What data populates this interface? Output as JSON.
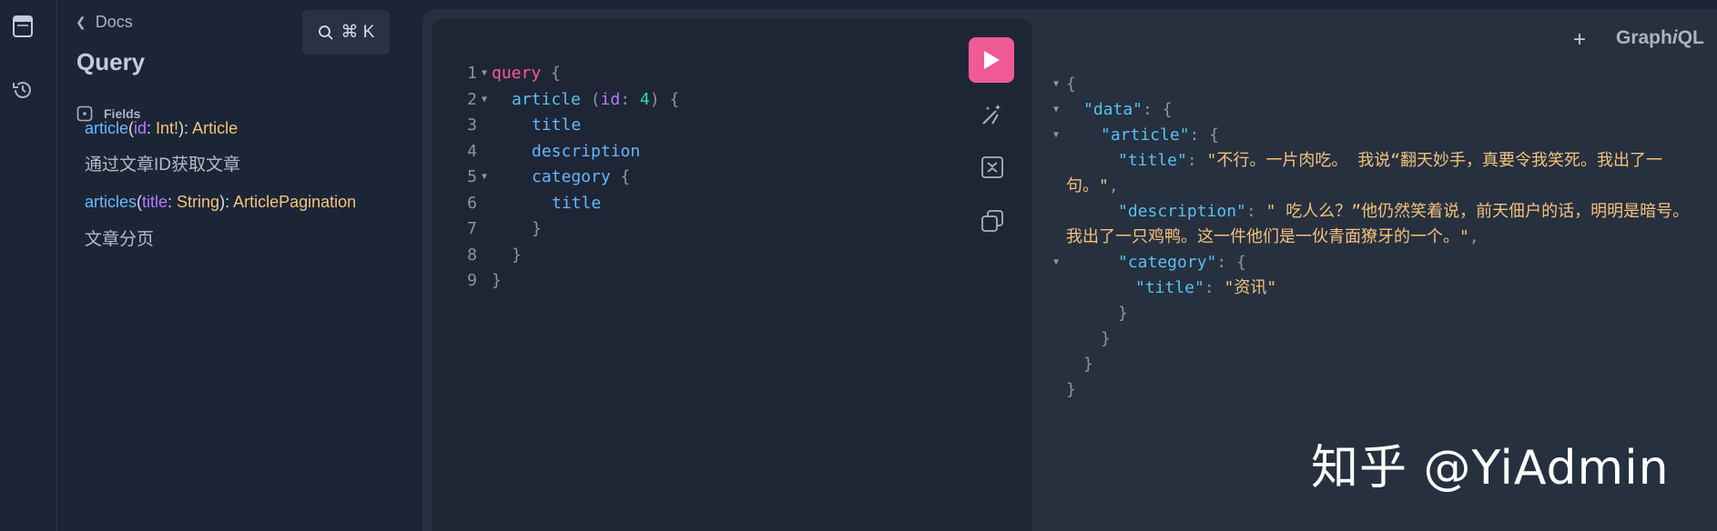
{
  "rail": {
    "icons": [
      "docs-icon",
      "history-icon"
    ]
  },
  "docs": {
    "back_label": "Docs",
    "search_label": "⌘ K",
    "title": "Query",
    "fields_label": "Fields",
    "fields": [
      {
        "name": "article",
        "args": [
          {
            "name": "id",
            "type": "Int!"
          }
        ],
        "type": "Article",
        "description": "通过文章ID获取文章"
      },
      {
        "name": "articles",
        "args": [
          {
            "name": "title",
            "type": "String"
          }
        ],
        "type": "ArticlePagination",
        "description": "文章分页"
      }
    ]
  },
  "editor": {
    "line_numbers": [
      "1",
      "2",
      "3",
      "4",
      "5",
      "6",
      "7",
      "8",
      "9"
    ],
    "lines": [
      {
        "segments": [
          {
            "t": "query",
            "c": "kw"
          },
          {
            "t": " {",
            "c": "pc"
          }
        ],
        "indent": 0,
        "fold": true
      },
      {
        "segments": [
          {
            "t": "article",
            "c": "fn"
          },
          {
            "t": " (",
            "c": "pc"
          },
          {
            "t": "id",
            "c": "ag"
          },
          {
            "t": ": ",
            "c": "pc"
          },
          {
            "t": "4",
            "c": "nm"
          },
          {
            "t": ") {",
            "c": "pc"
          }
        ],
        "indent": 1,
        "fold": true
      },
      {
        "segments": [
          {
            "t": "title",
            "c": "fd"
          }
        ],
        "indent": 2,
        "fold": false
      },
      {
        "segments": [
          {
            "t": "description",
            "c": "fd"
          }
        ],
        "indent": 2,
        "fold": false
      },
      {
        "segments": [
          {
            "t": "category",
            "c": "fd"
          },
          {
            "t": " {",
            "c": "pc"
          }
        ],
        "indent": 2,
        "fold": true
      },
      {
        "segments": [
          {
            "t": "title",
            "c": "fd"
          }
        ],
        "indent": 3,
        "fold": false
      },
      {
        "segments": [
          {
            "t": "}",
            "c": "pc"
          }
        ],
        "indent": 2,
        "fold": false
      },
      {
        "segments": [
          {
            "t": "}",
            "c": "pc"
          }
        ],
        "indent": 1,
        "fold": false
      },
      {
        "segments": [
          {
            "t": "}",
            "c": "pc"
          }
        ],
        "indent": 0,
        "fold": false
      }
    ]
  },
  "toolbar": {
    "run_label": "Run",
    "prettify": "prettify-icon",
    "merge": "merge-fragments-icon",
    "copy": "copy-icon"
  },
  "result_header": {
    "add_tab": "+",
    "logo_text": "GraphiQL"
  },
  "result": {
    "lines": [
      {
        "fold": true,
        "indent": 0,
        "segments": [
          {
            "t": "{",
            "c": "rp"
          }
        ]
      },
      {
        "fold": true,
        "indent": 1,
        "segments": [
          {
            "t": "\"data\"",
            "c": "rk"
          },
          {
            "t": ": {",
            "c": "rp"
          }
        ]
      },
      {
        "fold": true,
        "indent": 2,
        "segments": [
          {
            "t": "\"article\"",
            "c": "rk"
          },
          {
            "t": ": {",
            "c": "rp"
          }
        ]
      },
      {
        "fold": false,
        "indent": 3,
        "segments": [
          {
            "t": "\"title\"",
            "c": "rk"
          },
          {
            "t": ": ",
            "c": "rp"
          },
          {
            "t": "\"不行。一片肉吃。 我说“翻天妙手，真要令我笑死。我出了一句。\"",
            "c": "rs"
          },
          {
            "t": ",",
            "c": "rp"
          }
        ]
      },
      {
        "fold": false,
        "indent": 3,
        "segments": [
          {
            "t": "\"description\"",
            "c": "rk"
          },
          {
            "t": ": ",
            "c": "rp"
          },
          {
            "t": "\" 吃人么？”他仍然笑着说，前天佃户的话，明明是暗号。我出了一只鸡鸭。这一件他们是一伙青面獠牙的一个。\"",
            "c": "rs"
          },
          {
            "t": ",",
            "c": "rp"
          }
        ]
      },
      {
        "fold": true,
        "indent": 3,
        "segments": [
          {
            "t": "\"category\"",
            "c": "rk"
          },
          {
            "t": ": {",
            "c": "rp"
          }
        ]
      },
      {
        "fold": false,
        "indent": 4,
        "segments": [
          {
            "t": "\"title\"",
            "c": "rk"
          },
          {
            "t": ": ",
            "c": "rp"
          },
          {
            "t": "\"资讯\"",
            "c": "rs"
          }
        ]
      },
      {
        "fold": false,
        "indent": 3,
        "segments": [
          {
            "t": "}",
            "c": "rp"
          }
        ]
      },
      {
        "fold": false,
        "indent": 2,
        "segments": [
          {
            "t": "}",
            "c": "rp"
          }
        ]
      },
      {
        "fold": false,
        "indent": 1,
        "segments": [
          {
            "t": "}",
            "c": "rp"
          }
        ]
      },
      {
        "fold": false,
        "indent": 0,
        "segments": [
          {
            "t": "}",
            "c": "rp"
          }
        ]
      }
    ]
  },
  "watermark": "知乎 @YiAdmin",
  "colors": {
    "accent": "#f05a96",
    "background": "#1c2535",
    "editor": "#1e2636"
  }
}
